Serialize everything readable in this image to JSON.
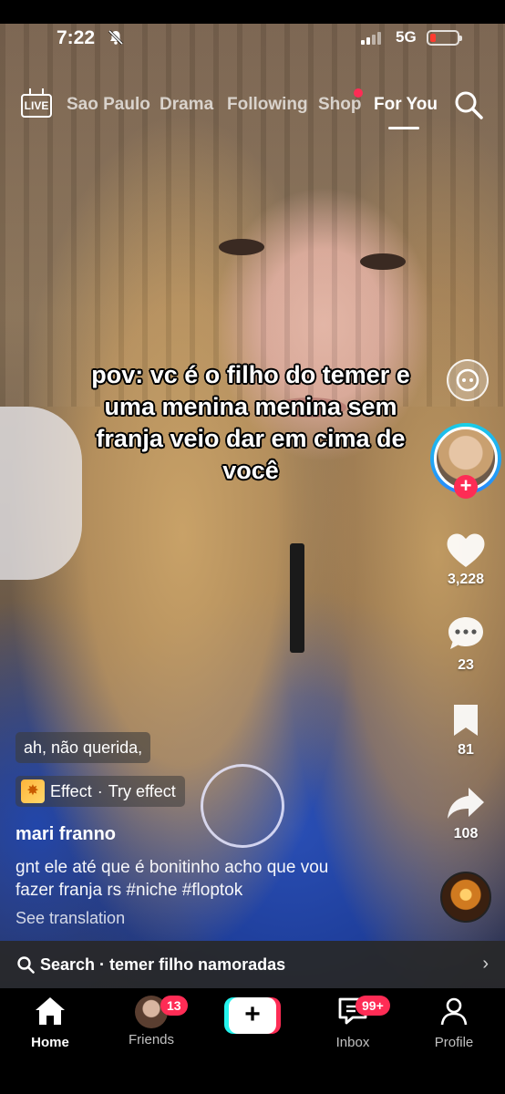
{
  "status_bar": {
    "time": "7:22",
    "network": "5G"
  },
  "top_nav": {
    "live_label": "LIVE",
    "tabs": [
      {
        "label": "Sao Paulo"
      },
      {
        "label": "Drama"
      },
      {
        "label": "Following"
      },
      {
        "label": "Shop"
      },
      {
        "label": "For You"
      }
    ],
    "active_tab": "For You"
  },
  "video": {
    "caption_lines": [
      "pov: vc é o filho do temer e",
      "uma menina menina sem",
      "franja veio dar em cima de",
      "você"
    ]
  },
  "right_rail": {
    "likes": "3,228",
    "comments": "23",
    "saves": "81",
    "shares": "108"
  },
  "info": {
    "sound_chip": "ah, não querida,",
    "effect_label": "Effect",
    "effect_action": "Try effect",
    "username": "mari franno",
    "description": "gnt ele até que é bonitinho acho que vou fazer franja rs #niche #floptok",
    "see_translation": "See translation"
  },
  "search_bar": {
    "prefix": "Search",
    "query": "temer filho namoradas"
  },
  "bottom_nav": {
    "items": [
      {
        "label": "Home",
        "icon": "home-icon"
      },
      {
        "label": "Friends",
        "badge": "13"
      },
      {
        "label": "Inbox",
        "badge": "99+",
        "icon": "inbox-icon"
      },
      {
        "label": "Profile",
        "icon": "profile-icon"
      }
    ],
    "active": "Home"
  },
  "colors": {
    "accent": "#fe2c55",
    "cyan": "#25f4ee"
  }
}
